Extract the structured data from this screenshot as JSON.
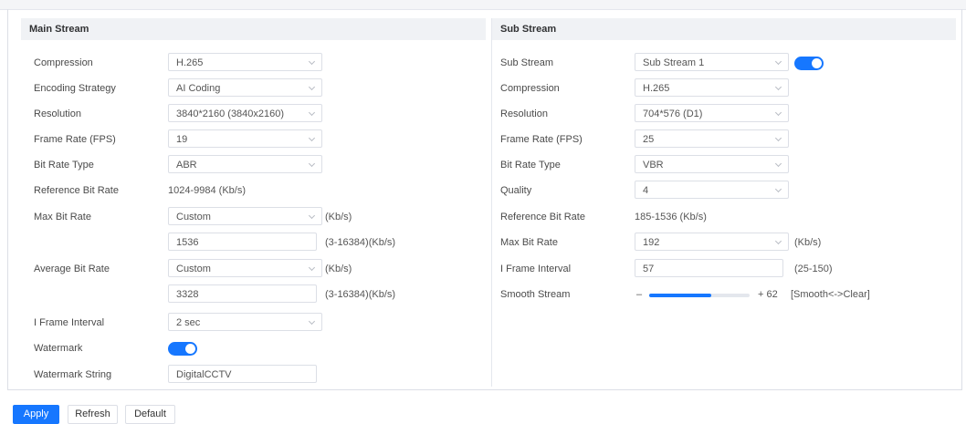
{
  "main": {
    "title": "Main Stream",
    "compression": {
      "label": "Compression",
      "value": "H.265"
    },
    "encoding_strategy": {
      "label": "Encoding Strategy",
      "value": "AI Coding"
    },
    "resolution": {
      "label": "Resolution",
      "value": "3840*2160 (3840x2160)"
    },
    "frame_rate": {
      "label": "Frame Rate (FPS)",
      "value": "19"
    },
    "bit_rate_type": {
      "label": "Bit Rate Type",
      "value": "ABR"
    },
    "reference_bit_rate": {
      "label": "Reference Bit Rate",
      "value": "1024-9984 (Kb/s)"
    },
    "max_bit_rate": {
      "label": "Max Bit Rate",
      "mode": "Custom",
      "unit": "(Kb/s)",
      "value": "1536",
      "range": "(3-16384)(Kb/s)"
    },
    "average_bit_rate": {
      "label": "Average Bit Rate",
      "mode": "Custom",
      "unit": "(Kb/s)",
      "value": "3328",
      "range": "(3-16384)(Kb/s)"
    },
    "i_frame_interval": {
      "label": "I Frame Interval",
      "value": "2 sec"
    },
    "watermark": {
      "label": "Watermark",
      "enabled": true
    },
    "watermark_string": {
      "label": "Watermark String",
      "value": "DigitalCCTV"
    }
  },
  "sub": {
    "title": "Sub Stream",
    "sub_stream": {
      "label": "Sub Stream",
      "value": "Sub Stream 1",
      "enabled": true
    },
    "compression": {
      "label": "Compression",
      "value": "H.265"
    },
    "resolution": {
      "label": "Resolution",
      "value": "704*576 (D1)"
    },
    "frame_rate": {
      "label": "Frame Rate (FPS)",
      "value": "25"
    },
    "bit_rate_type": {
      "label": "Bit Rate Type",
      "value": "VBR"
    },
    "quality": {
      "label": "Quality",
      "value": "4"
    },
    "reference_bit_rate": {
      "label": "Reference Bit Rate",
      "value": "185-1536 (Kb/s)"
    },
    "max_bit_rate": {
      "label": "Max Bit Rate",
      "value": "192",
      "unit": "(Kb/s)"
    },
    "i_frame_interval": {
      "label": "I Frame Interval",
      "value": "57",
      "range": "(25-150)"
    },
    "smooth_stream": {
      "label": "Smooth Stream",
      "minus": "–",
      "plus": "+ 62",
      "hint": "[Smooth<->Clear]",
      "level": 62
    }
  },
  "buttons": {
    "apply": "Apply",
    "refresh": "Refresh",
    "default": "Default"
  },
  "colors": {
    "accent": "#1677ff"
  }
}
